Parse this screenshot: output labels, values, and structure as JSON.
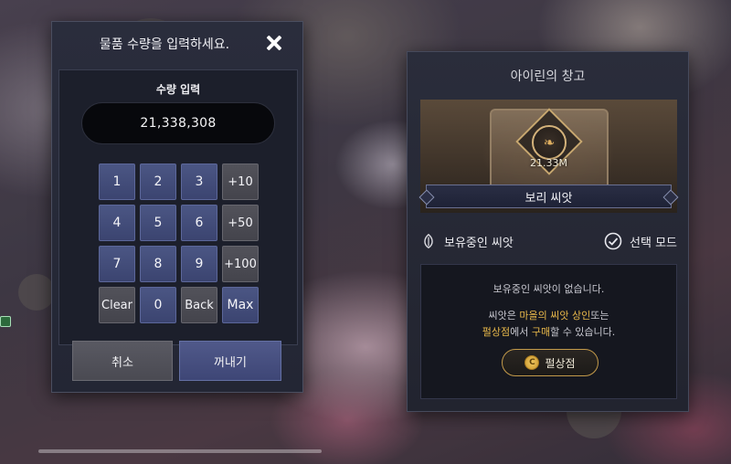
{
  "numpad_dialog": {
    "title": "물품 수량을 입력하세요.",
    "quantity_label": "수량 입력",
    "quantity_value": "21,338,308",
    "keys": [
      {
        "label": "1",
        "kind": "digit"
      },
      {
        "label": "2",
        "kind": "digit"
      },
      {
        "label": "3",
        "kind": "digit"
      },
      {
        "label": "+10",
        "kind": "util"
      },
      {
        "label": "4",
        "kind": "digit"
      },
      {
        "label": "5",
        "kind": "digit"
      },
      {
        "label": "6",
        "kind": "digit"
      },
      {
        "label": "+50",
        "kind": "util"
      },
      {
        "label": "7",
        "kind": "digit"
      },
      {
        "label": "8",
        "kind": "digit"
      },
      {
        "label": "9",
        "kind": "digit"
      },
      {
        "label": "+100",
        "kind": "util"
      },
      {
        "label": "Clear",
        "kind": "util"
      },
      {
        "label": "0",
        "kind": "digit"
      },
      {
        "label": "Back",
        "kind": "util"
      },
      {
        "label": "Max",
        "kind": "digit"
      }
    ],
    "cancel_label": "취소",
    "confirm_label": "꺼내기"
  },
  "warehouse_panel": {
    "title": "아이린의 창고",
    "item_quantity": "21.33M",
    "item_name": "보리 씨앗",
    "filter_label": "보유중인 씨앗",
    "mode_label": "선택 모드",
    "empty_message": "보유중인 씨앗이 없습니다.",
    "info_line1_prefix": "씨앗은 ",
    "info_line1_highlight": "마을의 씨앗 상인",
    "info_line1_suffix": "또는",
    "info_line2_highlight1": "펄상점",
    "info_line2_middle": "에서 ",
    "info_line2_highlight2": "구매",
    "info_line2_suffix": "할 수 있습니다.",
    "shop_button_label": "펄상점",
    "coin_symbol": "C"
  },
  "colors": {
    "highlight": "#e8b84a",
    "key_blue": "#4b5684",
    "key_gray": "#52525a"
  }
}
